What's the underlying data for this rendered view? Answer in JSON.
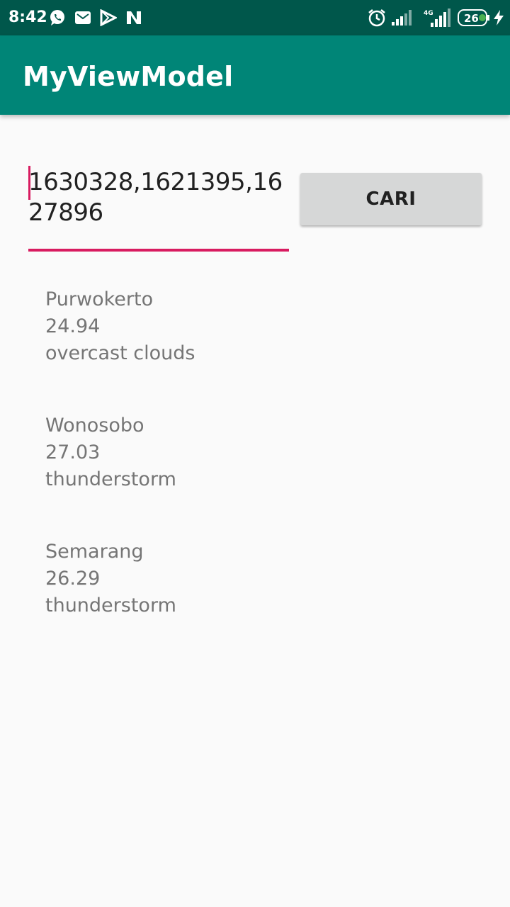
{
  "status_bar": {
    "time": "8:42",
    "battery": "26",
    "network": "4G",
    "icons": [
      "whatsapp-icon",
      "mail-icon",
      "play-icon",
      "n-icon",
      "alarm-icon",
      "signal-icon",
      "signal-4g-icon",
      "battery-icon",
      "charging-icon"
    ]
  },
  "app_bar": {
    "title": "MyViewModel",
    "color": "#008577",
    "status_color": "#00574b"
  },
  "search": {
    "value": "1630328,1621395,1627896",
    "accent": "#d81b60"
  },
  "button": {
    "label": "CARI"
  },
  "weather": [
    {
      "city": "Purwokerto",
      "temp": "24.94",
      "desc": "overcast clouds"
    },
    {
      "city": "Wonosobo",
      "temp": "27.03",
      "desc": "thunderstorm"
    },
    {
      "city": "Semarang",
      "temp": "26.29",
      "desc": "thunderstorm"
    }
  ]
}
